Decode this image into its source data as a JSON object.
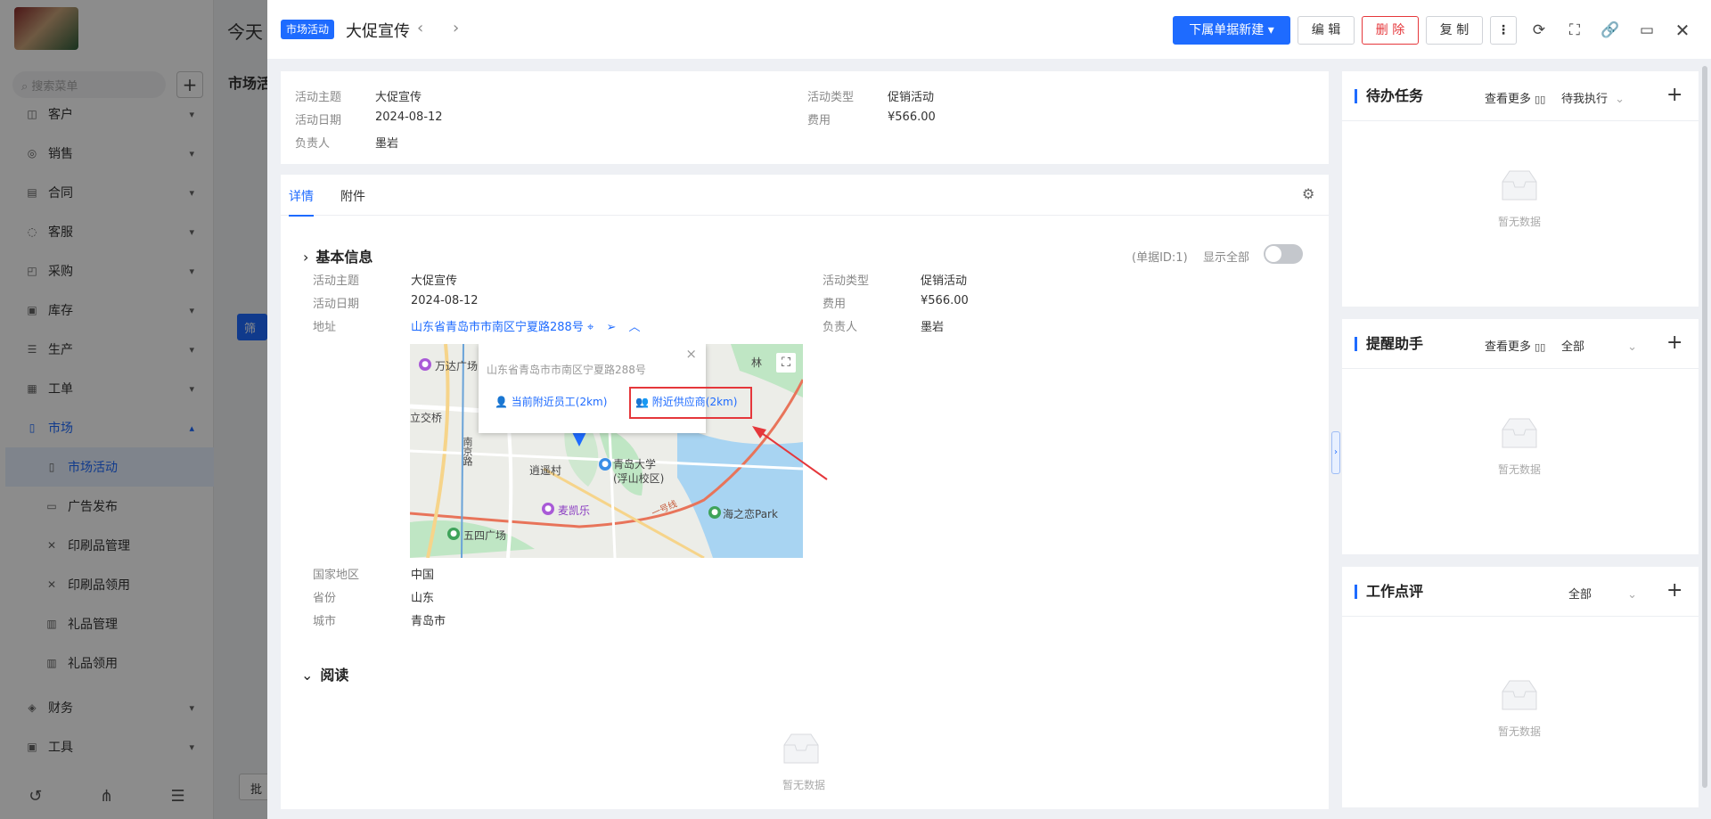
{
  "background": {
    "sidebar": {
      "search_placeholder": "搜索菜单",
      "items": [
        {
          "icon": "customer-icon",
          "label": "客户"
        },
        {
          "icon": "sales-icon",
          "label": "销售"
        },
        {
          "icon": "contract-icon",
          "label": "合同"
        },
        {
          "icon": "service-icon",
          "label": "客服"
        },
        {
          "icon": "purchase-icon",
          "label": "采购"
        },
        {
          "icon": "inventory-icon",
          "label": "库存"
        },
        {
          "icon": "production-icon",
          "label": "生产"
        },
        {
          "icon": "workorder-icon",
          "label": "工单"
        },
        {
          "icon": "market-icon",
          "label": "市场"
        }
      ],
      "sub_items": [
        "市场活动",
        "广告发布",
        "印刷品管理",
        "印刷品领用",
        "礼品管理",
        "礼品领用"
      ],
      "tail_items": [
        {
          "icon": "finance-icon",
          "label": "财务"
        },
        {
          "icon": "tools-icon",
          "label": "工具"
        }
      ]
    },
    "main_title": "今天",
    "main_subtitle": "市场活",
    "filter_label": "筛",
    "batch_label": "批"
  },
  "drawer": {
    "type_tag": "市场活动",
    "title": "大促宣传",
    "toolbar": {
      "new_sub_label": "下属单据新建",
      "edit_label": "编 辑",
      "delete_label": "删 除",
      "copy_label": "复 制"
    },
    "summary": {
      "left": [
        {
          "label": "活动主题",
          "value": "大促宣传"
        },
        {
          "label": "活动日期",
          "value": "2024-08-12"
        },
        {
          "label": "负责人",
          "value": "墨岩"
        }
      ],
      "right": [
        {
          "label": "活动类型",
          "value": "促销活动"
        },
        {
          "label": "费用",
          "value": "¥566.00"
        }
      ]
    },
    "tabs": [
      "详情",
      "附件"
    ],
    "basic_info": {
      "title": "基本信息",
      "doc_id": "(单据ID:1)",
      "show_all_label": "显示全部",
      "left": [
        {
          "label": "活动主题",
          "value": "大促宣传"
        },
        {
          "label": "活动日期",
          "value": "2024-08-12"
        }
      ],
      "address_label": "地址",
      "address_value": "山东省青岛市市南区宁夏路288号",
      "right": [
        {
          "label": "活动类型",
          "value": "促销活动"
        },
        {
          "label": "费用",
          "value": "¥566.00"
        },
        {
          "label": "负责人",
          "value": "墨岩"
        }
      ],
      "after_map": [
        {
          "label": "国家地区",
          "value": "中国"
        },
        {
          "label": "省份",
          "value": "山东"
        },
        {
          "label": "城市",
          "value": "青岛市"
        }
      ]
    },
    "map": {
      "popup_address": "山东省青岛市市南区宁夏路288号",
      "nearby_staff": "当前附近员工(2km)",
      "nearby_supplier": "附近供应商(2km)",
      "labels": {
        "wanda": "万达广场",
        "lijiao": "立交桥",
        "nanjing": "南京路",
        "xiaoyao": "逍遥村",
        "qdu": "青岛大学",
        "qdu_campus": "(浮山校区)",
        "maikaile": "麦凯乐",
        "wusi": "五四广场",
        "haizhilian": "海之恋Park",
        "road": "一号线",
        "top_right": "林"
      }
    },
    "reading": {
      "title": "阅读",
      "empty": "暂无数据"
    },
    "right_panels": [
      {
        "title": "待办任务",
        "more": "查看更多",
        "filter": "待我执行",
        "empty": "暂无数据"
      },
      {
        "title": "提醒助手",
        "more": "查看更多",
        "filter": "全部",
        "empty": "暂无数据"
      },
      {
        "title": "工作点评",
        "filter": "全部",
        "empty": "暂无数据"
      }
    ]
  },
  "colors": {
    "primary": "#1e6bff",
    "danger": "#e5373b"
  }
}
